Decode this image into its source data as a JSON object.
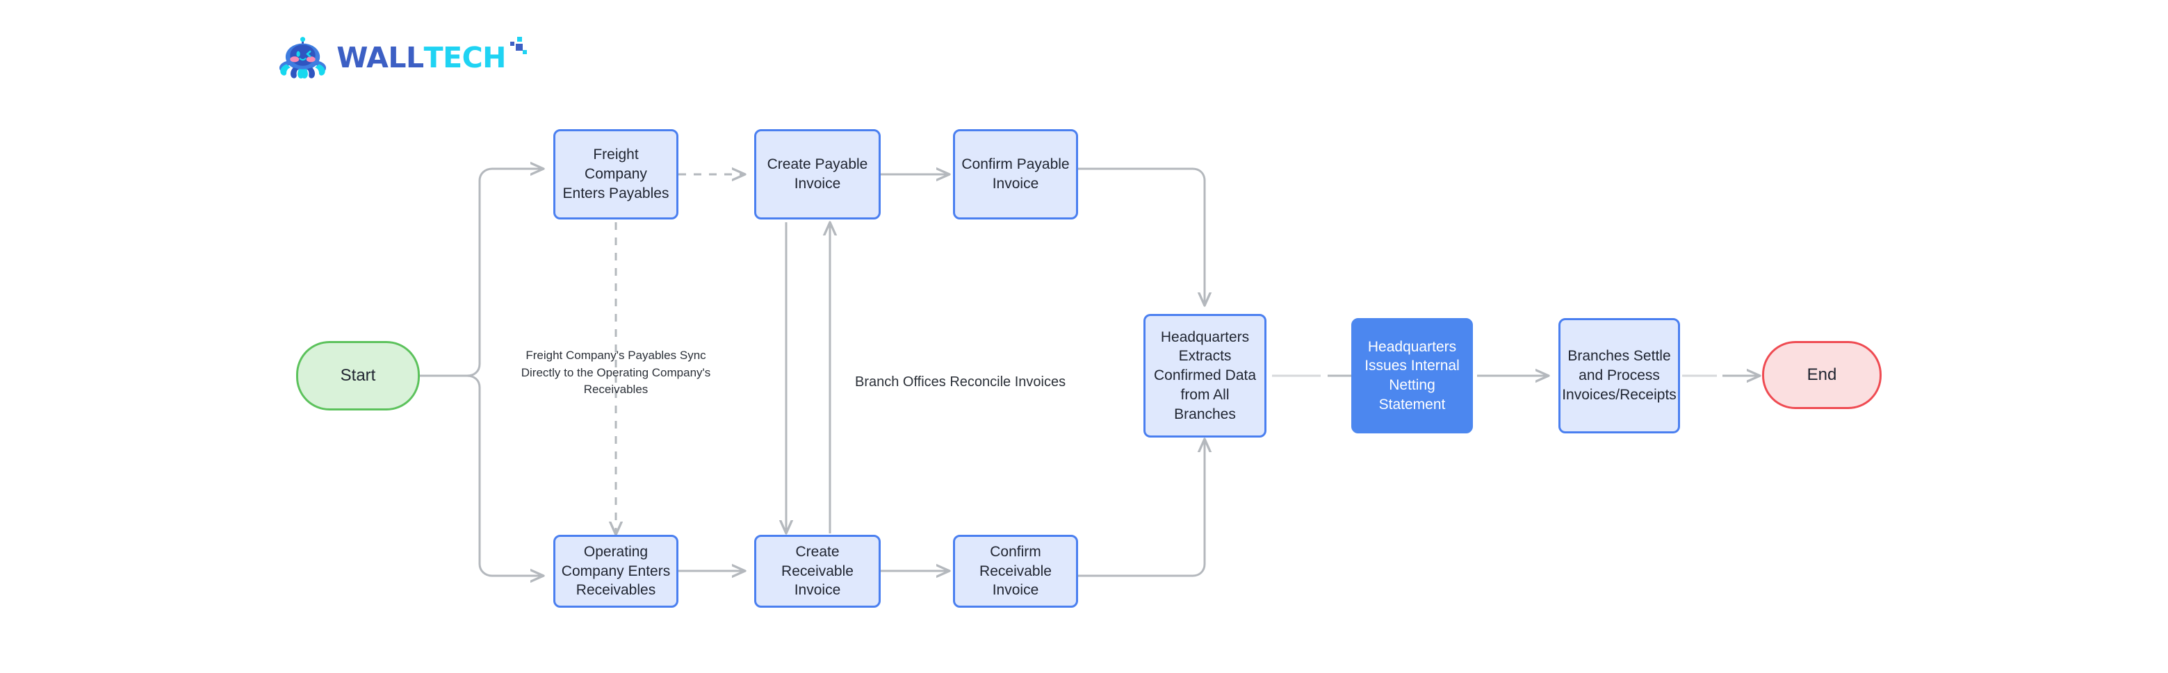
{
  "brand": {
    "logo_icon": "octopus-mascot-icon",
    "wordmark_part1": "WALL",
    "wordmark_part2": "TECH",
    "colors": {
      "wordmark_primary": "#3c5fc4",
      "wordmark_accent": "#1fd3f3",
      "mascot_body": "#2f55c0",
      "mascot_light": "#3f7de0",
      "mascot_cyan": "#17d8ef",
      "mascot_cheek": "#f98bb5"
    }
  },
  "diagram": {
    "type": "flowchart",
    "colors": {
      "node_fill": "#dfe8fd",
      "node_border": "#4a7ff0",
      "node_filled_bg": "#4c87ef",
      "node_filled_text": "#ffffff",
      "start_fill": "#d9f2d9",
      "start_border": "#5cc25c",
      "end_fill": "#fbdfe0",
      "end_border": "#ef4b52",
      "connector": "#b4b8bd",
      "text": "#1f2430"
    },
    "nodes": [
      {
        "id": "start",
        "label": "Start",
        "shape": "terminator",
        "style": "start"
      },
      {
        "id": "freight_payables",
        "label": "Freight Company\nEnters Payables",
        "shape": "process",
        "style": "outline"
      },
      {
        "id": "create_payable",
        "label": "Create Payable\nInvoice",
        "shape": "process",
        "style": "outline"
      },
      {
        "id": "confirm_payable",
        "label": "Confirm Payable\nInvoice",
        "shape": "process",
        "style": "outline"
      },
      {
        "id": "operating_recv",
        "label": "Operating\nCompany Enters\nReceivables",
        "shape": "process",
        "style": "outline"
      },
      {
        "id": "create_recv",
        "label": "Create Receivable\nInvoice",
        "shape": "process",
        "style": "outline"
      },
      {
        "id": "confirm_recv",
        "label": "Confirm\nReceivable Invoice",
        "shape": "process",
        "style": "outline"
      },
      {
        "id": "hq_extracts",
        "label": "Headquarters\nExtracts\nConfirmed Data\nfrom All Branches",
        "shape": "process",
        "style": "outline"
      },
      {
        "id": "hq_netting",
        "label": "Headquarters\nIssues Internal\nNetting Statement",
        "shape": "process",
        "style": "filled"
      },
      {
        "id": "branches_settle",
        "label": "Branches Settle\nand Process\nInvoices/Receipts",
        "shape": "process",
        "style": "outline"
      },
      {
        "id": "end",
        "label": "End",
        "shape": "terminator",
        "style": "end"
      }
    ],
    "edge_labels": [
      {
        "id": "sync_label",
        "text": "Freight Company's Payables Sync\nDirectly to the Operating Company's\nReceivables"
      },
      {
        "id": "reconcile_label",
        "text": "Branch Offices Reconcile Invoices"
      }
    ],
    "edges": [
      {
        "from": "start",
        "to": "freight_payables",
        "style": "solid"
      },
      {
        "from": "start",
        "to": "operating_recv",
        "style": "solid"
      },
      {
        "from": "freight_payables",
        "to": "create_payable",
        "style": "dashed"
      },
      {
        "from": "freight_payables",
        "to": "operating_recv",
        "style": "dashed",
        "label": "sync_label"
      },
      {
        "from": "create_payable",
        "to": "confirm_payable",
        "style": "solid"
      },
      {
        "from": "create_payable",
        "to": "create_recv",
        "style": "solid"
      },
      {
        "from": "create_recv",
        "to": "create_payable",
        "style": "solid",
        "label": "reconcile_label"
      },
      {
        "from": "operating_recv",
        "to": "create_recv",
        "style": "solid"
      },
      {
        "from": "create_recv",
        "to": "confirm_recv",
        "style": "solid"
      },
      {
        "from": "confirm_payable",
        "to": "hq_extracts",
        "style": "solid"
      },
      {
        "from": "confirm_recv",
        "to": "hq_extracts",
        "style": "solid"
      },
      {
        "from": "hq_extracts",
        "to": "hq_netting",
        "style": "solid"
      },
      {
        "from": "hq_netting",
        "to": "branches_settle",
        "style": "solid"
      },
      {
        "from": "branches_settle",
        "to": "end",
        "style": "solid"
      }
    ]
  }
}
